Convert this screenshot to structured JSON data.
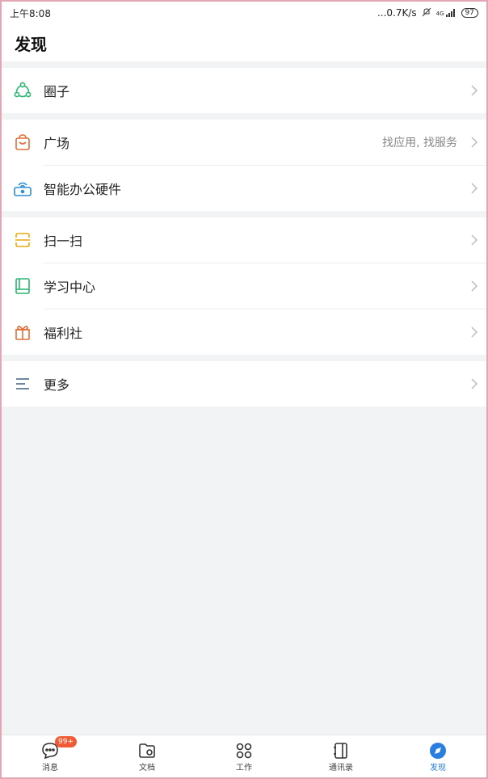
{
  "status": {
    "time": "上午8:08",
    "network": "...0.7K/s",
    "signal_label": "4G",
    "battery": "97"
  },
  "header": {
    "title": "发现"
  },
  "groups": [
    {
      "items": [
        {
          "label": "圈子",
          "icon": "circle-group-icon",
          "color": "#2bb673"
        }
      ]
    },
    {
      "items": [
        {
          "label": "广场",
          "sub": "找应用, 找服务",
          "icon": "shopping-bag-icon",
          "color": "#e0703a"
        },
        {
          "label": "智能办公硬件",
          "icon": "router-icon",
          "color": "#2a8fd6"
        }
      ]
    },
    {
      "items": [
        {
          "label": "扫一扫",
          "icon": "scan-icon",
          "color": "#e8a80f"
        },
        {
          "label": "学习中心",
          "icon": "book-icon",
          "color": "#2bb673"
        },
        {
          "label": "福利社",
          "icon": "gift-icon",
          "color": "#e0703a"
        }
      ]
    },
    {
      "items": [
        {
          "label": "更多",
          "icon": "menu-icon",
          "color": "#4b6b8a"
        }
      ]
    }
  ],
  "tabs": [
    {
      "label": "消息",
      "badge": "99+",
      "icon": "chat-icon"
    },
    {
      "label": "文档",
      "icon": "folder-icon"
    },
    {
      "label": "工作",
      "icon": "grid-icon"
    },
    {
      "label": "通讯录",
      "icon": "contacts-icon"
    },
    {
      "label": "发现",
      "icon": "discover-icon",
      "active": true
    }
  ]
}
